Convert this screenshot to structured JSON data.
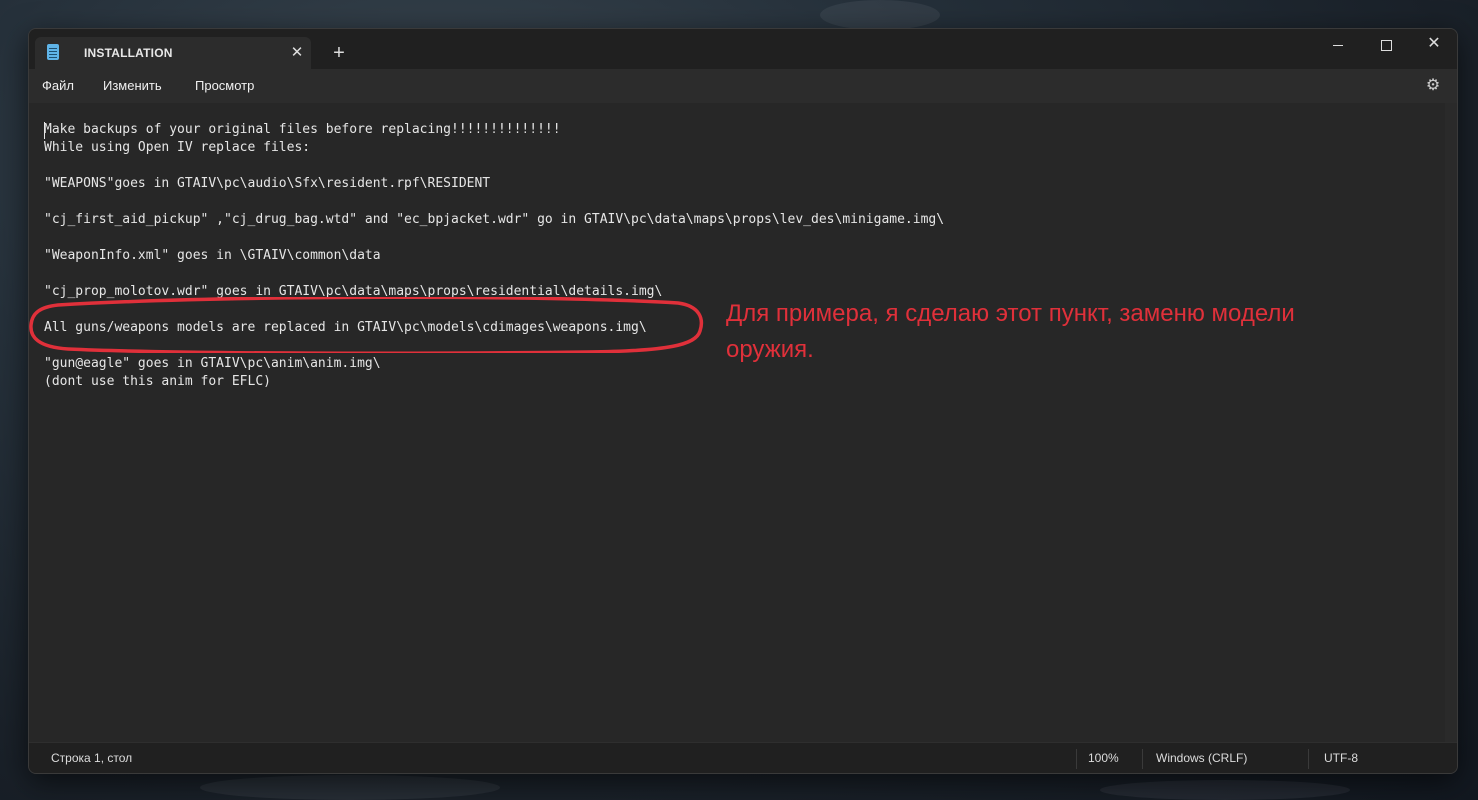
{
  "tab": {
    "title": "INSTALLATION",
    "close": "✕",
    "new": "+"
  },
  "window_controls": {
    "close": "✕"
  },
  "menu": {
    "file": "Файл",
    "edit": "Изменить",
    "view": "Просмотр"
  },
  "settings_icon": "⚙",
  "document": {
    "lines": [
      "Make backups of your original files before replacing!!!!!!!!!!!!!!",
      "While using Open IV replace files:",
      "\"WEAPONS\"goes in GTAIV\\pc\\audio\\Sfx\\resident.rpf\\RESIDENT",
      "\"cj_first_aid_pickup\" ,\"cj_drug_bag.wtd\" and \"ec_bpjacket.wdr\" go in GTAIV\\pc\\data\\maps\\props\\lev_des\\minigame.img\\",
      "\"WeaponInfo.xml\" goes in \\GTAIV\\common\\data",
      "\"cj_prop_molotov.wdr\" goes in GTAIV\\pc\\data\\maps\\props\\residential\\details.img\\",
      "All guns/weapons models are replaced in GTAIV\\pc\\models\\cdimages\\weapons.img\\",
      "\"gun@eagle\" goes in GTAIV\\pc\\anim\\anim.img\\",
      "(dont use this anim for EFLC)"
    ]
  },
  "annotation": {
    "text": "Для примера, я сделаю этот пункт, заменю модели оружия.",
    "color": "#e0303a"
  },
  "status": {
    "position": "Строка 1, стол",
    "zoom": "100%",
    "line_ending": "Windows (CRLF)",
    "encoding": "UTF-8"
  }
}
